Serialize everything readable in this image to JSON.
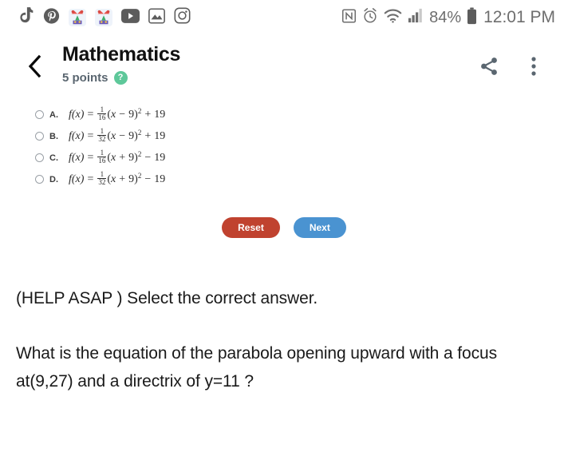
{
  "status_bar": {
    "left_icons": [
      {
        "name": "tiktok-icon",
        "label": "TikTok"
      },
      {
        "name": "pinterest-icon",
        "label": "Pinterest"
      },
      {
        "name": "party-app-icon-1",
        "label": "App notification"
      },
      {
        "name": "party-app-icon-2",
        "label": "App notification"
      },
      {
        "name": "youtube-icon",
        "label": "YouTube"
      },
      {
        "name": "gallery-icon",
        "label": "Gallery"
      },
      {
        "name": "instagram-icon",
        "label": "Instagram"
      }
    ],
    "right_icons": [
      {
        "name": "nfc-icon",
        "label": "NFC"
      },
      {
        "name": "alarm-icon",
        "label": "Alarm"
      },
      {
        "name": "wifi-icon",
        "label": "Wi-Fi"
      },
      {
        "name": "signal-icon",
        "label": "Signal"
      }
    ],
    "battery_percent": "84%",
    "clock": "12:01 PM"
  },
  "header": {
    "back_label": "Back",
    "title": "Mathematics",
    "points": "5 points",
    "help_glyph": "?",
    "share_label": "Share",
    "more_label": "More options"
  },
  "options": [
    {
      "letter": "A.",
      "selected": false,
      "math": {
        "fx": "f(x)",
        "equals": "=",
        "numerator": "1",
        "denominator": "16",
        "open_paren": "(",
        "var": "x",
        "sign": "−",
        "inner_const": "9",
        "close_paren": ")",
        "power": "2",
        "tail_sign": "+",
        "tail_const": "19"
      },
      "plain": "f(x) = 1/16(x − 9)² + 19"
    },
    {
      "letter": "B.",
      "selected": false,
      "math": {
        "fx": "f(x)",
        "equals": "=",
        "numerator": "1",
        "denominator": "32",
        "open_paren": "(",
        "var": "x",
        "sign": "−",
        "inner_const": "9",
        "close_paren": ")",
        "power": "2",
        "tail_sign": "+",
        "tail_const": "19"
      },
      "plain": "f(x) = 1/32(x − 9)² + 19"
    },
    {
      "letter": "C.",
      "selected": false,
      "math": {
        "fx": "f(x)",
        "equals": "=",
        "numerator": "1",
        "denominator": "16",
        "open_paren": "(",
        "var": "x",
        "sign": "+",
        "inner_const": "9",
        "close_paren": ")",
        "power": "2",
        "tail_sign": "−",
        "tail_const": "19"
      },
      "plain": "f(x) = 1/16(x + 9)² − 19"
    },
    {
      "letter": "D.",
      "selected": false,
      "math": {
        "fx": "f(x)",
        "equals": "=",
        "numerator": "1",
        "denominator": "32",
        "open_paren": "(",
        "var": "x",
        "sign": "+",
        "inner_const": "9",
        "close_paren": ")",
        "power": "2",
        "tail_sign": "−",
        "tail_const": "19"
      },
      "plain": "f(x) = 1/32(x + 9)² − 19"
    }
  ],
  "buttons": {
    "reset_label": "Reset",
    "next_label": "Next",
    "reset_color": "#c0422f",
    "next_color": "#4a93d1"
  },
  "question": {
    "intro": "(HELP ASAP ) Select the correct answer.",
    "body": "What is the equation of the parabola opening upward with a focus at(9,27) and a directrix of y=11 ?"
  },
  "colors": {
    "accent_green": "#5ec89a",
    "points_text": "#5a6670",
    "status_gray": "#6e6e6e",
    "title_black": "#111111"
  }
}
